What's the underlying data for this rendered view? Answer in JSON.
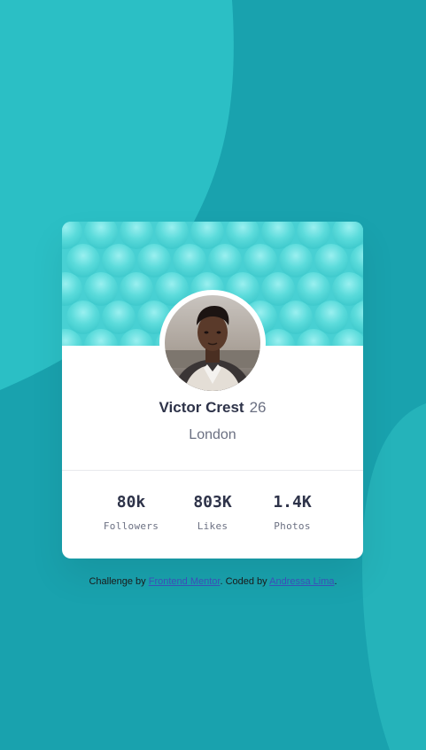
{
  "colors": {
    "background": "#19a2ae",
    "background_light": "#2bbfc5",
    "card": "#ffffff",
    "text_dark": "#2e3349",
    "text_gray": "#6b7082",
    "link": "#3b4fb8"
  },
  "profile": {
    "name": "Victor Crest",
    "age": "26",
    "location": "London",
    "avatar_icon": "profile-photo"
  },
  "stats": [
    {
      "value": "80k",
      "label": "Followers"
    },
    {
      "value": "803K",
      "label": "Likes"
    },
    {
      "value": "1.4K",
      "label": "Photos"
    }
  ],
  "attribution": {
    "prefix": "Challenge by ",
    "challenge_link": "Frontend Mentor",
    "middle": ". Coded by ",
    "author_link": "Andressa Lima",
    "suffix": "."
  }
}
